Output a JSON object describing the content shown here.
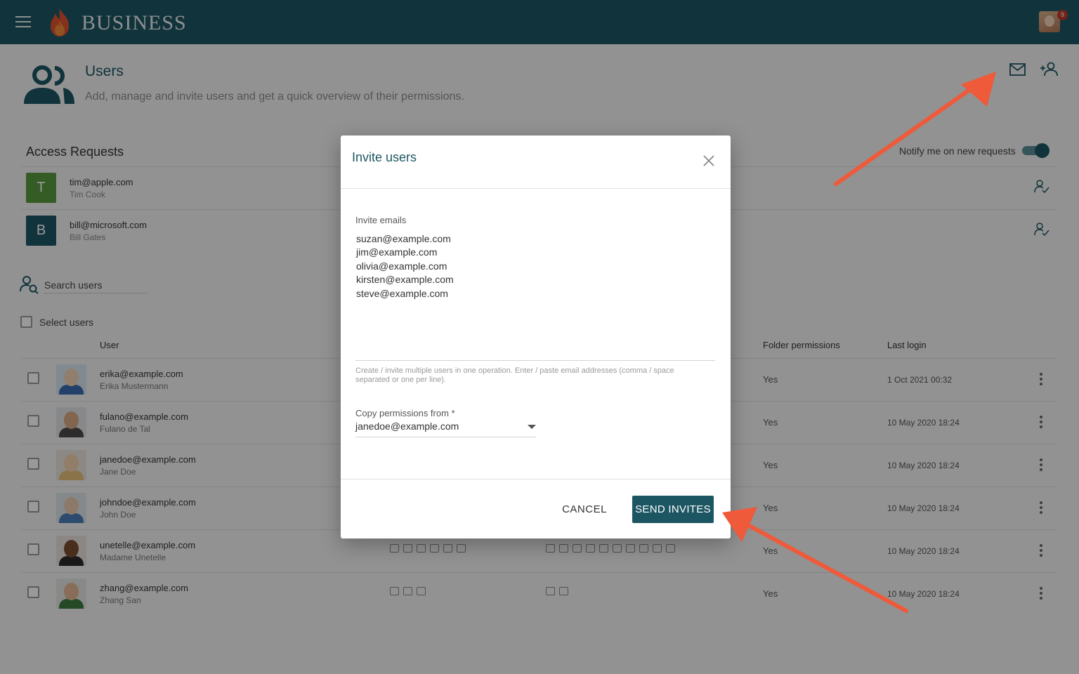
{
  "header": {
    "brand": "BUSINESS",
    "notification_count": "9"
  },
  "page": {
    "title": "Users",
    "subtitle": "Add, manage and invite users and get a quick overview of their permissions."
  },
  "access_requests": {
    "title": "Access Requests",
    "notify_label": "Notify me on new requests",
    "notify_enabled": true,
    "items": [
      {
        "initial": "T",
        "email": "tim@apple.com",
        "name": "Tim Cook",
        "color": "#5b9a3f"
      },
      {
        "initial": "B",
        "email": "bill@microsoft.com",
        "name": "Bill Gates",
        "color": "#1d5663"
      }
    ]
  },
  "search": {
    "label": "Search users"
  },
  "select_users_label": "Select users",
  "table": {
    "columns": {
      "user": "User",
      "folder_permissions": "Folder permissions",
      "last_login": "Last login"
    },
    "rows": [
      {
        "email": "erika@example.com",
        "name": "Erika Mustermann",
        "folder": "Yes",
        "login": "1 Oct 2021 00:32",
        "shirt": "#3a6bb0"
      },
      {
        "email": "fulano@example.com",
        "name": "Fulano de Tal",
        "folder": "Yes",
        "login": "10 May 2020 18:24",
        "shirt": "#4a4a4a"
      },
      {
        "email": "janedoe@example.com",
        "name": "Jane Doe",
        "folder": "Yes",
        "login": "10 May 2020 18:24",
        "shirt": "#e7c07a"
      },
      {
        "email": "johndoe@example.com",
        "name": "John Doe",
        "folder": "Yes",
        "login": "10 May 2020 18:24",
        "shirt": "#4b7db8"
      },
      {
        "email": "unetelle@example.com",
        "name": "Madame Unetelle",
        "folder": "Yes",
        "login": "10 May 2020 18:24",
        "shirt": "#2a2a2a"
      },
      {
        "email": "zhang@example.com",
        "name": "Zhang San",
        "folder": "Yes",
        "login": "10 May 2020 18:24",
        "shirt": "#3c7a3c"
      }
    ]
  },
  "modal": {
    "title": "Invite users",
    "emails_label": "Invite emails",
    "emails_value": "suzan@example.com\njim@example.com\nolivia@example.com\nkirsten@example.com\nsteve@example.com",
    "helper": "Create / invite multiple users in one operation. Enter / paste email addresses (comma / space separated or one per line).",
    "copy_label": "Copy permissions from *",
    "copy_value": "janedoe@example.com",
    "cancel": "CANCEL",
    "send": "SEND INVITES"
  },
  "colors": {
    "brand": "#1d5663",
    "annotation_arrow": "#ee5a3a"
  }
}
